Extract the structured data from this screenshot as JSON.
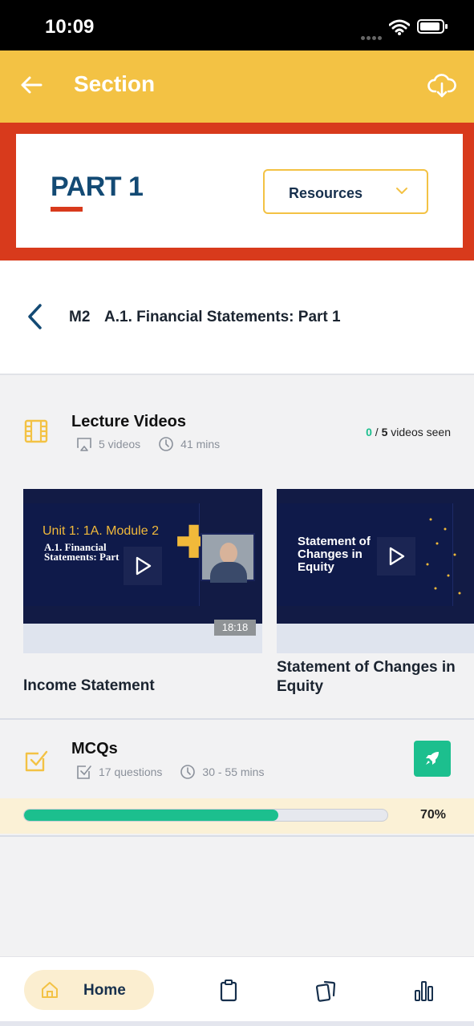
{
  "status_bar": {
    "time": "10:09"
  },
  "header": {
    "title": "Section",
    "back_icon": "arrow-left-icon",
    "download_icon": "cloud-download-icon"
  },
  "part": {
    "title": "PART 1",
    "resources_label": "Resources"
  },
  "module": {
    "code": "M2",
    "title": "A.1. Financial Statements: Part 1"
  },
  "lectures": {
    "title": "Lecture Videos",
    "video_count": "5 videos",
    "duration": "41 mins",
    "seen_count": "0",
    "seen_total": "5",
    "seen_suffix": " videos seen",
    "videos": [
      {
        "thumb_heading": "Unit 1: 1A. Module 2",
        "thumb_subtitle_1": "A.1. Financial",
        "thumb_subtitle_2": "Statements: Part",
        "duration": "18:18",
        "label": "Income Statement"
      },
      {
        "thumb_title_1": "Statement of",
        "thumb_title_2": "Changes in",
        "thumb_title_3": "Equity",
        "label_line_1": "Statement of Changes in",
        "label_line_2": "Equity"
      }
    ]
  },
  "mcqs": {
    "title": "MCQs",
    "question_count": "17 questions",
    "duration": "30 - 55 mins",
    "progress_percent": 70,
    "progress_label": "70%"
  },
  "tabbar": {
    "home_label": "Home",
    "tabs": [
      "home-icon",
      "clipboard-icon",
      "cards-icon",
      "bar-chart-icon"
    ]
  },
  "colors": {
    "header": "#f3c244",
    "accent_red": "#d83a1c",
    "navy": "#134a74",
    "green": "#1cbf8e"
  }
}
